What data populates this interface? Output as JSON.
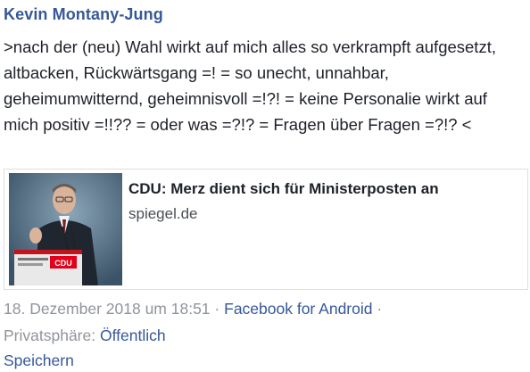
{
  "post": {
    "author": "Kevin Montany-Jung",
    "text": ">nach der (neu) Wahl wirkt auf mich alles so verkrampft aufgesetzt, altbacken, Rückwärtsgang =! = so unecht, unnahbar, geheimumwitternd, geheimnisvoll =!?! = keine Personalie wirkt auf mich positiv =!!?? = oder was =?!? = Fragen über Fragen =?!? <"
  },
  "link_preview": {
    "title": "CDU: Merz dient sich für Ministerposten an",
    "domain": "spiegel.de",
    "thumbnail_logo": "CDU"
  },
  "meta": {
    "timestamp": "18. Dezember 2018 um 18:51",
    "separator": "·",
    "source": "Facebook for Android",
    "privacy_label": "Privatsphäre:",
    "privacy_value": "Öffentlich",
    "save_label": "Speichern"
  },
  "colors": {
    "link": "#365899",
    "text": "#1d2129",
    "muted": "#90949c"
  }
}
